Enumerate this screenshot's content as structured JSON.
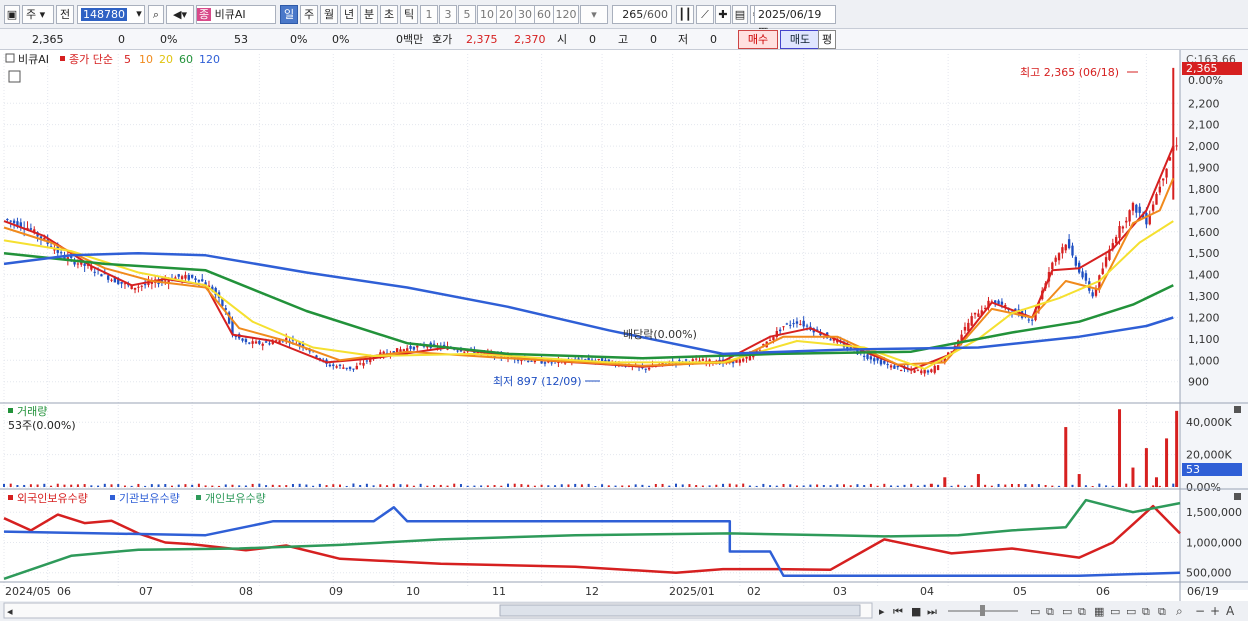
{
  "toolbar": {
    "period_type": "주",
    "jeon_label": "전",
    "stock_code": "148780",
    "search_badge": "종",
    "stock_name": "비큐AI",
    "periods": [
      "일",
      "주",
      "월",
      "년",
      "분",
      "초",
      "틱"
    ],
    "active_period": "일",
    "intervals": [
      "1",
      "3",
      "5",
      "10",
      "20",
      "30",
      "60",
      "120"
    ],
    "count": "265",
    "count_total": "/600",
    "date": "2025/06/19"
  },
  "infobar": {
    "price": "2,365",
    "change": "0",
    "change_pct": "0%",
    "volume": "53",
    "vol_pct": "0%",
    "pct3": "0%",
    "amount": "0백만",
    "ask_label": "호가",
    "ask": "2,375",
    "bid": "2,370",
    "open_label": "시",
    "open": "0",
    "high_label": "고",
    "high": "0",
    "low_label": "저",
    "low": "0",
    "buy": "매수",
    "sell": "매도",
    "flat": "평"
  },
  "colors": {
    "up": "#d62020",
    "down": "#1f4fc2",
    "ma5": "#d62020",
    "ma10": "#f08a1c",
    "ma20": "#f5e030",
    "ma60": "#22923a",
    "ma120": "#2f5fd6",
    "foreign": "#d62020",
    "institution": "#2f5fd6",
    "individual": "#2e9a5a"
  },
  "chart_data": [
    {
      "type": "candlestick",
      "title": "비큐AI",
      "legend": {
        "label": "종가 단순",
        "periods": [
          "5",
          "10",
          "20",
          "60",
          "120"
        ]
      },
      "x_dates": [
        "2024/05",
        "06",
        "07",
        "08",
        "09",
        "10",
        "11",
        "12",
        "2025/01",
        "02",
        "03",
        "04",
        "05",
        "06",
        "06/19"
      ],
      "y_ticks": [
        900,
        1000,
        1100,
        1200,
        1300,
        1400,
        1500,
        1600,
        1700,
        1800,
        1900,
        2000,
        2100,
        2200
      ],
      "y_tick_labels": [
        "900",
        "1,000",
        "1,100",
        "1,200",
        "1,300",
        "1,400",
        "1,500",
        "1,600",
        "1,700",
        "1,800",
        "1,900",
        "2,000",
        "2,100",
        "2,200"
      ],
      "ylim": [
        810,
        2430
      ],
      "right_top_label": "C:163.66",
      "right_pct_label": "0.00%",
      "last_price_label": "2,365",
      "annotations": {
        "high": "최고 2,365 (06/18)",
        "low": "최저 897 (12/09)",
        "dividend": "배당락(0.00%)"
      },
      "close_path": [
        [
          0,
          1660
        ],
        [
          7,
          1620
        ],
        [
          12,
          1560
        ],
        [
          18,
          1480
        ],
        [
          26,
          1430
        ],
        [
          32,
          1380
        ],
        [
          38,
          1340
        ],
        [
          44,
          1360
        ],
        [
          52,
          1390
        ],
        [
          58,
          1380
        ],
        [
          62,
          1330
        ],
        [
          66,
          1230
        ],
        [
          68,
          1120
        ],
        [
          72,
          1080
        ],
        [
          78,
          1080
        ],
        [
          84,
          1100
        ],
        [
          90,
          1060
        ],
        [
          96,
          980
        ],
        [
          104,
          960
        ],
        [
          110,
          1020
        ],
        [
          118,
          1050
        ],
        [
          126,
          1070
        ],
        [
          132,
          1060
        ],
        [
          140,
          1040
        ],
        [
          148,
          1020
        ],
        [
          156,
          1000
        ],
        [
          162,
          990
        ],
        [
          168,
          1000
        ],
        [
          176,
          1000
        ],
        [
          184,
          980
        ],
        [
          190,
          960
        ],
        [
          198,
          990
        ],
        [
          206,
          1000
        ],
        [
          214,
          990
        ],
        [
          220,
          1000
        ],
        [
          226,
          1070
        ],
        [
          232,
          1160
        ],
        [
          236,
          1180
        ],
        [
          240,
          1150
        ],
        [
          246,
          1100
        ],
        [
          252,
          1050
        ],
        [
          258,
          1010
        ],
        [
          264,
          970
        ],
        [
          270,
          950
        ],
        [
          276,
          950
        ],
        [
          282,
          1050
        ],
        [
          288,
          1200
        ],
        [
          294,
          1280
        ],
        [
          300,
          1230
        ],
        [
          306,
          1190
        ],
        [
          312,
          1460
        ],
        [
          316,
          1550
        ],
        [
          320,
          1420
        ],
        [
          324,
          1300
        ],
        [
          330,
          1560
        ],
        [
          336,
          1720
        ],
        [
          340,
          1650
        ],
        [
          344,
          1820
        ],
        [
          348,
          2000
        ]
      ],
      "ma_paths": [
        {
          "period": "5",
          "points": [
            [
              0,
              1650
            ],
            [
              12,
              1580
            ],
            [
              26,
              1440
            ],
            [
              38,
              1350
            ],
            [
              48,
              1380
            ],
            [
              60,
              1350
            ],
            [
              68,
              1120
            ],
            [
              80,
              1090
            ],
            [
              96,
              990
            ],
            [
              110,
              1010
            ],
            [
              132,
              1060
            ],
            [
              160,
              1000
            ],
            [
              190,
              970
            ],
            [
              214,
              995
            ],
            [
              228,
              1110
            ],
            [
              240,
              1150
            ],
            [
              256,
              1040
            ],
            [
              270,
              955
            ],
            [
              282,
              1030
            ],
            [
              294,
              1270
            ],
            [
              306,
              1200
            ],
            [
              312,
              1420
            ],
            [
              320,
              1430
            ],
            [
              330,
              1520
            ],
            [
              340,
              1700
            ],
            [
              348,
              2000
            ]
          ]
        },
        {
          "period": "10",
          "points": [
            [
              0,
              1620
            ],
            [
              14,
              1550
            ],
            [
              30,
              1430
            ],
            [
              44,
              1370
            ],
            [
              60,
              1340
            ],
            [
              70,
              1150
            ],
            [
              84,
              1090
            ],
            [
              100,
              1000
            ],
            [
              120,
              1040
            ],
            [
              150,
              1010
            ],
            [
              190,
              975
            ],
            [
              216,
              990
            ],
            [
              232,
              1110
            ],
            [
              248,
              1110
            ],
            [
              266,
              980
            ],
            [
              280,
              990
            ],
            [
              294,
              1240
            ],
            [
              306,
              1200
            ],
            [
              316,
              1370
            ],
            [
              326,
              1330
            ],
            [
              336,
              1640
            ],
            [
              344,
              1700
            ],
            [
              348,
              1850
            ]
          ]
        },
        {
          "period": "20",
          "points": [
            [
              0,
              1560
            ],
            [
              20,
              1510
            ],
            [
              40,
              1410
            ],
            [
              60,
              1350
            ],
            [
              74,
              1180
            ],
            [
              92,
              1060
            ],
            [
              110,
              1020
            ],
            [
              140,
              1030
            ],
            [
              180,
              990
            ],
            [
              214,
              990
            ],
            [
              236,
              1090
            ],
            [
              256,
              1060
            ],
            [
              274,
              960
            ],
            [
              290,
              1100
            ],
            [
              300,
              1220
            ],
            [
              314,
              1290
            ],
            [
              326,
              1370
            ],
            [
              338,
              1550
            ],
            [
              348,
              1650
            ]
          ]
        },
        {
          "period": "60",
          "points": [
            [
              0,
              1500
            ],
            [
              30,
              1450
            ],
            [
              60,
              1420
            ],
            [
              90,
              1230
            ],
            [
              120,
              1080
            ],
            [
              150,
              1030
            ],
            [
              190,
              1010
            ],
            [
              230,
              1030
            ],
            [
              270,
              1040
            ],
            [
              300,
              1130
            ],
            [
              320,
              1180
            ],
            [
              336,
              1260
            ],
            [
              348,
              1350
            ]
          ]
        },
        {
          "period": "120",
          "points": [
            [
              0,
              1450
            ],
            [
              20,
              1490
            ],
            [
              40,
              1500
            ],
            [
              60,
              1490
            ],
            [
              90,
              1410
            ],
            [
              120,
              1340
            ],
            [
              150,
              1250
            ],
            [
              180,
              1140
            ],
            [
              214,
              1030
            ],
            [
              250,
              1050
            ],
            [
              290,
              1060
            ],
            [
              320,
              1110
            ],
            [
              340,
              1160
            ],
            [
              348,
              1200
            ]
          ]
        }
      ]
    },
    {
      "type": "bar",
      "title": "거래량",
      "subtitle": "53주(0.00%)",
      "y_tick_labels": [
        "40,000K",
        "20,000K",
        "0.00%"
      ],
      "ylim": [
        0,
        50000
      ],
      "last_value_label": "53",
      "spikes": [
        {
          "x": 276,
          "value": 2000
        },
        {
          "x": 280,
          "value": 6000
        },
        {
          "x": 290,
          "value": 8000
        },
        {
          "x": 316,
          "value": 37000
        },
        {
          "x": 320,
          "value": 8000
        },
        {
          "x": 332,
          "value": 48000
        },
        {
          "x": 336,
          "value": 12000
        },
        {
          "x": 340,
          "value": 24000
        },
        {
          "x": 343,
          "value": 6000
        },
        {
          "x": 346,
          "value": 30000
        },
        {
          "x": 349,
          "value": 47000
        }
      ]
    },
    {
      "type": "line",
      "series": [
        {
          "name": "외국인보유수량",
          "points": [
            [
              0,
              1400000
            ],
            [
              8,
              1200000
            ],
            [
              16,
              1460000
            ],
            [
              24,
              1320000
            ],
            [
              32,
              1360000
            ],
            [
              40,
              1150000
            ],
            [
              48,
              1000000
            ],
            [
              56,
              970000
            ],
            [
              64,
              920000
            ],
            [
              72,
              870000
            ],
            [
              84,
              950000
            ],
            [
              100,
              730000
            ],
            [
              130,
              650000
            ],
            [
              170,
              600000
            ],
            [
              200,
              500000
            ],
            [
              214,
              560000
            ],
            [
              230,
              560000
            ],
            [
              246,
              550000
            ],
            [
              262,
              1050000
            ],
            [
              282,
              820000
            ],
            [
              300,
              900000
            ],
            [
              320,
              750000
            ],
            [
              330,
              1000000
            ],
            [
              336,
              1300000
            ],
            [
              342,
              1600000
            ],
            [
              350,
              1150000
            ]
          ]
        },
        {
          "name": "기관보유수량",
          "points": [
            [
              0,
              1180000
            ],
            [
              60,
              1120000
            ],
            [
              80,
              1350000
            ],
            [
              110,
              1350000
            ],
            [
              116,
              1580000
            ],
            [
              120,
              1350000
            ],
            [
              200,
              1350000
            ],
            [
              216,
              1350000
            ],
            [
              216,
              850000
            ],
            [
              228,
              850000
            ],
            [
              232,
              450000
            ],
            [
              320,
              450000
            ],
            [
              350,
              500000
            ]
          ]
        },
        {
          "name": "개인보유수량",
          "points": [
            [
              0,
              400000
            ],
            [
              20,
              780000
            ],
            [
              40,
              880000
            ],
            [
              70,
              900000
            ],
            [
              100,
              960000
            ],
            [
              130,
              1050000
            ],
            [
              170,
              1120000
            ],
            [
              216,
              1150000
            ],
            [
              246,
              1120000
            ],
            [
              262,
              1100000
            ],
            [
              284,
              1120000
            ],
            [
              300,
              1200000
            ],
            [
              316,
              1250000
            ],
            [
              322,
              1700000
            ],
            [
              336,
              1500000
            ],
            [
              350,
              1650000
            ]
          ]
        }
      ],
      "y_tick_labels": [
        "1,500,000",
        "1,000,000",
        "500,000"
      ],
      "ylim": [
        380000,
        1850000
      ]
    }
  ]
}
